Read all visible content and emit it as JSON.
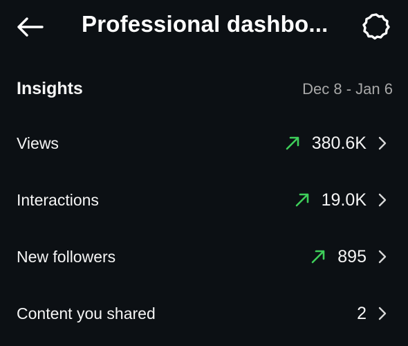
{
  "header": {
    "title": "Professional dashbo...",
    "back_icon": "arrow-left-icon",
    "settings_icon": "gear-icon"
  },
  "insights": {
    "title": "Insights",
    "date_range": "Dec 8 - Jan 6"
  },
  "metrics": [
    {
      "label": "Views",
      "value": "380.6K",
      "trend": "up"
    },
    {
      "label": "Interactions",
      "value": "19.0K",
      "trend": "up"
    },
    {
      "label": "New followers",
      "value": "895",
      "trend": "up"
    },
    {
      "label": "Content you shared",
      "value": "2",
      "trend": "none"
    }
  ],
  "colors": {
    "background": "#0c1014",
    "text": "#f5f5f5",
    "muted": "#a8a8a8",
    "trend_up": "#3ecf5a"
  }
}
